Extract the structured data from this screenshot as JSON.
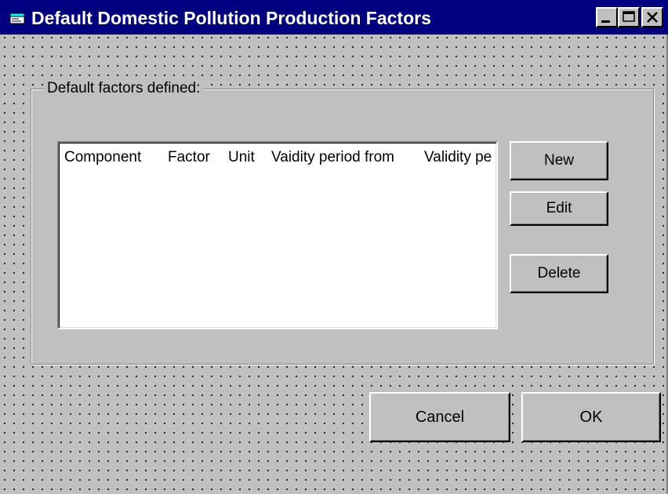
{
  "window": {
    "title": "Default Domestic Pollution Production Factors",
    "title_icon": "app-window-icon",
    "title_bar_color": "#000080",
    "face_color": "#c0c0c0",
    "controls": {
      "minimize": "minimize-icon",
      "maximize": "maximize-icon",
      "close": "close-icon"
    }
  },
  "group": {
    "label": "Default factors defined:"
  },
  "list": {
    "columns": [
      "Component",
      "Factor",
      "Unit",
      "Vaidity period from",
      "Validity pe"
    ],
    "rows": []
  },
  "buttons": {
    "new": "New",
    "edit": "Edit",
    "delete": "Delete",
    "cancel": "Cancel",
    "ok": "OK"
  }
}
